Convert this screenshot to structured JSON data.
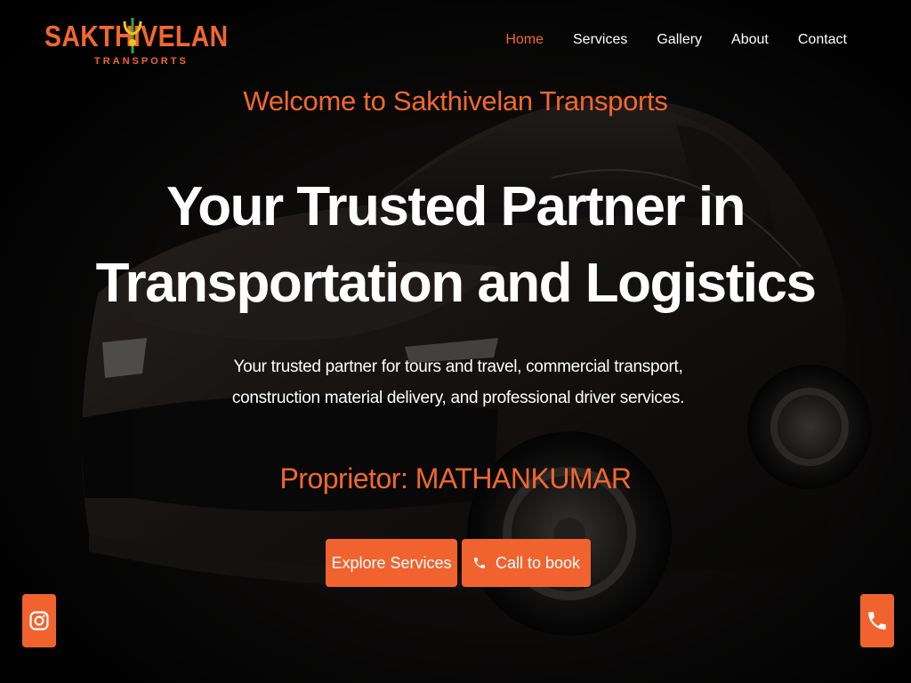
{
  "brand": {
    "name": "SAKTHIVELAN",
    "tagline": "TRANSPORTS"
  },
  "nav": {
    "items": [
      {
        "label": "Home",
        "active": true
      },
      {
        "label": "Services",
        "active": false
      },
      {
        "label": "Gallery",
        "active": false
      },
      {
        "label": "About",
        "active": false
      },
      {
        "label": "Contact",
        "active": false
      }
    ]
  },
  "hero": {
    "welcome": "Welcome to Sakthivelan Transports",
    "headline_line1": "Your Trusted Partner in",
    "headline_line2": "Transportation and Logistics",
    "description_line1": "Your trusted partner for tours and travel, commercial transport,",
    "description_line2": "construction material delivery, and professional driver services.",
    "proprietor": "Proprietor: MATHANKUMAR"
  },
  "buttons": {
    "explore_label": "Explore Services",
    "call_label": "Call to book"
  },
  "floating": {
    "left_icon": "instagram-icon",
    "right_icon": "phone-icon"
  },
  "colors": {
    "accent": "#f0682e",
    "text": "#ffffff",
    "background": "#000000"
  }
}
